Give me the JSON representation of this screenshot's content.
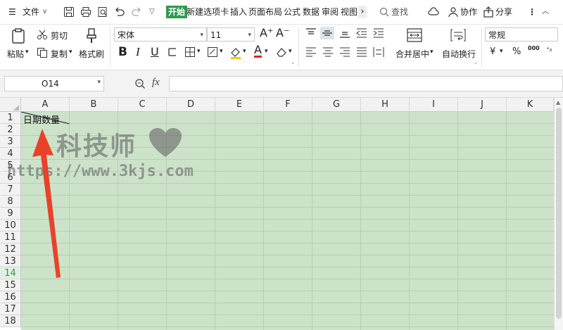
{
  "menubar": {
    "file_label": "文件",
    "tabs": [
      "开始",
      "新建选项卡",
      "插入",
      "页面布局",
      "公式",
      "数据",
      "审阅",
      "视图"
    ],
    "more_glyph": "›",
    "search_label": "查找",
    "collab_label": "协作",
    "share_label": "分享"
  },
  "ribbon": {
    "paste_label": "粘贴",
    "cut_label": "剪切",
    "copy_label": "复制",
    "format_painter_label": "格式刷",
    "font_name": "宋体",
    "font_size": "11",
    "bold": "B",
    "italic": "I",
    "underline": "U",
    "font_color_glyph": "A",
    "merge_center_label": "合并居中",
    "wrap_text_label": "自动换行",
    "number_format": "常规",
    "currency_glyph": "¥",
    "percent_glyph": "%",
    "thousands_glyph": "000"
  },
  "formula_bar": {
    "name_box": "O14",
    "fx": "fx",
    "formula": ""
  },
  "sheet": {
    "columns": [
      "A",
      "B",
      "C",
      "D",
      "E",
      "F",
      "G",
      "H",
      "I",
      "J",
      "K"
    ],
    "rows": [
      "1",
      "2",
      "3",
      "4",
      "5",
      "6",
      "7",
      "8",
      "9",
      "10",
      "11",
      "12",
      "13",
      "14",
      "15",
      "16",
      "17",
      "18"
    ],
    "selected_row": "14",
    "cell_a1": "日期数量"
  },
  "watermark": {
    "title": "科技师",
    "url": "https://www.3kjs.com"
  },
  "colors": {
    "accent": "#2f9a4f",
    "cell_bg": "#cce3c9",
    "arrow": "#e8432a"
  }
}
